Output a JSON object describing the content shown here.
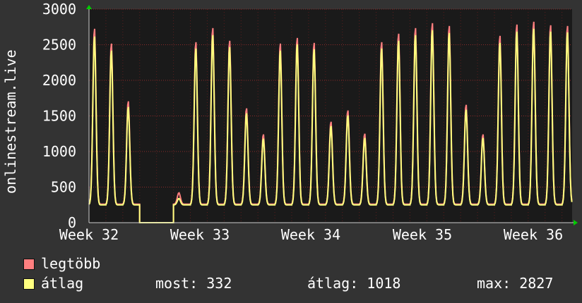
{
  "chart_data": {
    "type": "line",
    "ylabel": "onlinestream.live",
    "ylim": [
      0,
      3000
    ],
    "y_ticks": [
      "0",
      "500",
      "1000",
      "1500",
      "2000",
      "2500",
      "3000"
    ],
    "x_ticks": [
      "Week 32",
      "Week 33",
      "Week 34",
      "Week 35",
      "Week 36"
    ],
    "grid": true,
    "daily_peaks": [
      {
        "day": 1,
        "max": 2750,
        "avg": 2650
      },
      {
        "day": 2,
        "max": 2540,
        "avg": 2450
      },
      {
        "day": 3,
        "max": 1720,
        "avg": 1650
      },
      {
        "day": 4,
        "max": 0,
        "avg": 0
      },
      {
        "day": 5,
        "max": 0,
        "avg": 0
      },
      {
        "day": 6,
        "max": 420,
        "avg": 350
      },
      {
        "day": 7,
        "max": 2560,
        "avg": 2480
      },
      {
        "day": 8,
        "max": 2760,
        "avg": 2670
      },
      {
        "day": 9,
        "max": 2580,
        "avg": 2500
      },
      {
        "day": 10,
        "max": 1620,
        "avg": 1560
      },
      {
        "day": 11,
        "max": 1250,
        "avg": 1200
      },
      {
        "day": 12,
        "max": 2540,
        "avg": 2450
      },
      {
        "day": 13,
        "max": 2620,
        "avg": 2540
      },
      {
        "day": 14,
        "max": 2550,
        "avg": 2470
      },
      {
        "day": 15,
        "max": 1430,
        "avg": 1380
      },
      {
        "day": 16,
        "max": 1590,
        "avg": 1530
      },
      {
        "day": 17,
        "max": 1260,
        "avg": 1210
      },
      {
        "day": 18,
        "max": 2560,
        "avg": 2480
      },
      {
        "day": 19,
        "max": 2680,
        "avg": 2590
      },
      {
        "day": 20,
        "max": 2760,
        "avg": 2670
      },
      {
        "day": 21,
        "max": 2830,
        "avg": 2740
      },
      {
        "day": 22,
        "max": 2790,
        "avg": 2700
      },
      {
        "day": 23,
        "max": 1670,
        "avg": 1610
      },
      {
        "day": 24,
        "max": 1250,
        "avg": 1210
      },
      {
        "day": 25,
        "max": 2650,
        "avg": 2560
      },
      {
        "day": 26,
        "max": 2810,
        "avg": 2720
      },
      {
        "day": 27,
        "max": 2850,
        "avg": 2760
      },
      {
        "day": 28,
        "max": 2800,
        "avg": 2720
      },
      {
        "day": 29,
        "max": 2790,
        "avg": 2710
      }
    ],
    "series": [
      {
        "name": "legtöbb",
        "color": "#ff7f7f"
      },
      {
        "name": "átlag",
        "color": "#ffff7f"
      }
    ]
  },
  "legend": {
    "max_label": "legtöbb",
    "avg_label": "átlag",
    "max_color": "#ff7f7f",
    "avg_color": "#ffff7f"
  },
  "stats": {
    "current": "most: 332",
    "average": "átlag: 1018",
    "maximum": "max: 2827"
  }
}
